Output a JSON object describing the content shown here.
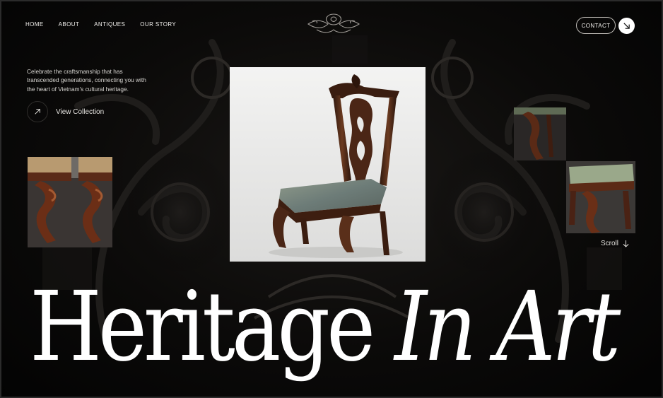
{
  "nav": {
    "items": [
      {
        "label": "HOME"
      },
      {
        "label": "ABOUT"
      },
      {
        "label": "ANTIQUES"
      },
      {
        "label": "OUR STORY"
      }
    ],
    "logo_icon": "ornamental-crest-icon",
    "contact_label": "CONTACT",
    "contact_icon": "arrow-down-right-icon"
  },
  "intro": {
    "text": "Celebrate the craftsmanship that has transcended generations, connecting you with the heart of Vietnam's cultural heritage.",
    "cta_label": "View Collection",
    "cta_icon": "arrow-up-right-icon"
  },
  "gallery": {
    "main_image": "antique-carved-chair",
    "left_image": "carved-chair-legs",
    "right_images": [
      "carved-leg-detail",
      "upholstered-chair-legs"
    ]
  },
  "scroll": {
    "label": "Scroll",
    "icon": "arrow-down-icon"
  },
  "headline": {
    "regular": "Heritage",
    "italic": "In Art"
  },
  "colors": {
    "background": "#050505",
    "text": "#ffffff",
    "wood": "#4a2616"
  }
}
